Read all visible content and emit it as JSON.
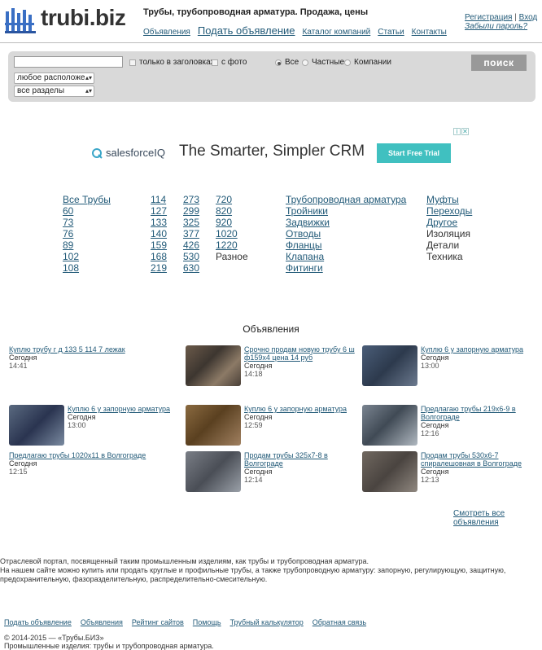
{
  "header": {
    "logo_text": "trubi.biz",
    "description": "Трубы, трубопроводная арматура. Продажа, цены",
    "nav": [
      {
        "label": "Объявления",
        "big": false
      },
      {
        "label": "Подать объявление",
        "big": true
      },
      {
        "label": "Каталог компаний",
        "big": false
      },
      {
        "label": "Статьи",
        "big": false
      },
      {
        "label": "Контакты",
        "big": false
      }
    ],
    "auth": {
      "register": "Регистрация",
      "separator": "|",
      "login": "Вход",
      "forgot": "Забыли пароль?"
    }
  },
  "search": {
    "query_value": "",
    "only_titles_label": "только в заголовках",
    "with_photo_label": "с фото",
    "seller_types": [
      {
        "label": "Все",
        "selected": true
      },
      {
        "label": "Частные",
        "selected": false
      },
      {
        "label": "Компании",
        "selected": false
      }
    ],
    "location_value": "любое расположе",
    "section_value": "все разделы",
    "button_label": "поиск"
  },
  "ad": {
    "brand": "salesforceIQ",
    "slogan": "The Smarter, Simpler CRM",
    "cta": "Start Free Trial",
    "info_icon": "i",
    "close_icon": "✕",
    "cta_color": "#40c0c0"
  },
  "categories": {
    "col1": [
      "Все Трубы",
      "60",
      "73",
      "76",
      "89",
      "102",
      "108"
    ],
    "col2": [
      "114",
      "127",
      "133",
      "140",
      "159",
      "168",
      "219"
    ],
    "col3": [
      "273",
      "299",
      "325",
      "377",
      "426",
      "530",
      "630"
    ],
    "col4": [
      {
        "label": "720",
        "link": true
      },
      {
        "label": "820",
        "link": true
      },
      {
        "label": "920",
        "link": true
      },
      {
        "label": "1020",
        "link": true
      },
      {
        "label": "1220",
        "link": true
      },
      {
        "label": "Разное",
        "link": false
      }
    ],
    "col5": [
      "Трубопроводная арматура",
      "Тройники",
      "Задвижки",
      "Отводы",
      "Фланцы",
      "Клапана",
      "Фитинги"
    ],
    "col6": [
      {
        "label": "Муфты",
        "link": true
      },
      {
        "label": "Переходы",
        "link": true
      },
      {
        "label": "Другое",
        "link": true
      },
      {
        "label": "Изоляция",
        "link": false
      },
      {
        "label": "Детали",
        "link": false
      },
      {
        "label": "Техника",
        "link": false
      }
    ]
  },
  "listings": {
    "title": "Объявления",
    "items": [
      {
        "title": "Куплю трубу г д 133 5 114 7 лежак",
        "date": "Сегодня",
        "time": "14:41",
        "has_image": false
      },
      {
        "title": "Срочно продам новую трубу 6 ш ф159х4 цена 14 руб",
        "date": "Сегодня",
        "time": "14:18",
        "has_image": true
      },
      {
        "title": "Куплю 6 у запорную арматура",
        "date": "Сегодня",
        "time": "13:00",
        "has_image": true
      },
      {
        "title": "Куплю 6 у запорную арматура",
        "date": "Сегодня",
        "time": "13:00",
        "has_image": true
      },
      {
        "title": "Куплю 6 у запорную арматура",
        "date": "Сегодня",
        "time": "12:59",
        "has_image": true
      },
      {
        "title": "Предлагаю трубы 219х6-9 в Волгограде",
        "date": "Сегодня",
        "time": "12:16",
        "has_image": true
      },
      {
        "title": "Предлагаю трубы 1020х11 в Волгограде",
        "date": "Сегодня",
        "time": "12:15",
        "has_image": false
      },
      {
        "title": "Продам трубы 325х7-8 в Волгограде",
        "date": "Сегодня",
        "time": "12:14",
        "has_image": true
      },
      {
        "title": "Продам трубы 530х6-7 спиралешовная в Волгограде",
        "date": "Сегодня",
        "time": "12:13",
        "has_image": true
      }
    ],
    "see_all": "Смотреть все объявления"
  },
  "footer": {
    "about_line1": "Отраслевой портал, посвященный таким промышленным изделиям, как трубы и трубопроводная арматура.",
    "about_line2": "На нашем сайте можно купить или продать круглые и профильные трубы, а также трубопроводную арматуру: запорную, регулирующую, защитную,",
    "about_line3": "предохранительную, фазоразделительную, распределительно-смесительную.",
    "nav": [
      "Подать объявление",
      "Объявления",
      "Рейтинг сайтов",
      "Помощь",
      "Трубный калькулятор",
      "Обратная связь"
    ],
    "copyright": "© 2014-2015 — «Трубы.БИЗ»",
    "tagline": "Промышленные изделия: трубы и трубопроводная арматура."
  }
}
